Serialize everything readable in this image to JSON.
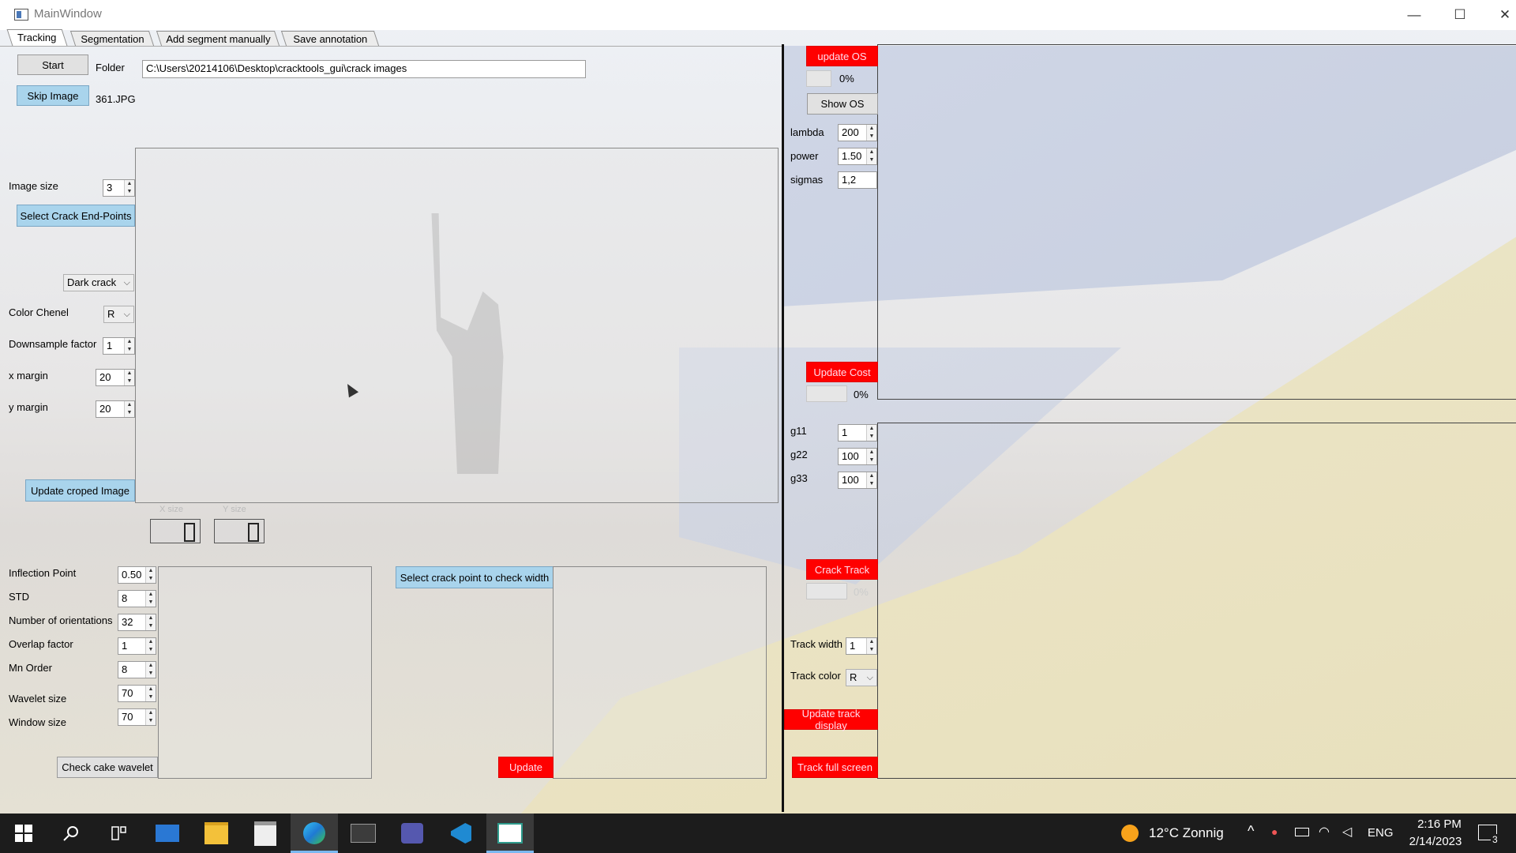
{
  "window": {
    "title": "MainWindow",
    "minimize": "—",
    "maximize": "☐",
    "close": "✕"
  },
  "tabs": [
    "Tracking",
    "Segmentation",
    "Add segment manually",
    "Save annotation"
  ],
  "left": {
    "start_label": "Start",
    "folder_label": "Folder",
    "folder_path": "C:\\Users\\20214106\\Desktop\\cracktools_gui\\crack images",
    "skip_label": "Skip Image",
    "filename": "361.JPG",
    "image_size_label": "Image size",
    "image_size_value": "3",
    "select_endpoints_label": "Select Crack End-Points",
    "crack_type": "Dark crack",
    "color_chenel_label": "Color Chenel",
    "color_chenel_value": "R",
    "downsample_label": "Downsample factor",
    "downsample_value": "1",
    "x_margin_label": "x margin",
    "x_margin_value": "20",
    "y_margin_label": "y margin",
    "y_margin_value": "20",
    "update_crop_label": "Update croped Image",
    "x_size_label": "X size",
    "y_size_label": "Y size"
  },
  "wavelet": {
    "inflection_label": "Inflection Point",
    "inflection_value": "0.50",
    "std_label": "STD",
    "std_value": "8",
    "orient_label": "Number of orientations",
    "orient_value": "32",
    "overlap_label": "Overlap factor",
    "overlap_value": "1",
    "mn_label": "Mn Order",
    "mn_value": "8",
    "wavelet_size_label": "Wavelet size",
    "wavelet_size_value": "70",
    "window_size_label": "Window size",
    "window_size_value": "70",
    "check_label": "Check cake wavelet"
  },
  "width_check": {
    "select_label": "Select crack point to check width",
    "update_label": "Update"
  },
  "right": {
    "update_os_label": "update OS",
    "os_progress": "0%",
    "show_os_label": "Show OS",
    "lambda_label": "lambda",
    "lambda_value": "200",
    "power_label": "power",
    "power_value": "1.50",
    "sigmas_label": "sigmas",
    "sigmas_value": "1,2",
    "update_cost_label": "Update Cost",
    "cost_progress": "0%",
    "g11_label": "g11",
    "g11_value": "1",
    "g22_label": "g22",
    "g22_value": "100",
    "g33_label": "g33",
    "g33_value": "100",
    "crack_track_label": "Crack Track",
    "track_progress": "0%",
    "track_width_label": "Track width",
    "track_width_value": "1",
    "track_color_label": "Track color",
    "track_color_value": "R",
    "update_display_label": "Update track display",
    "full_screen_label": "Track full screen"
  },
  "taskbar": {
    "weather": "12°C Zonnig",
    "lang": "ENG",
    "time": "2:16 PM",
    "date": "2/14/2023",
    "notifications": "3"
  }
}
